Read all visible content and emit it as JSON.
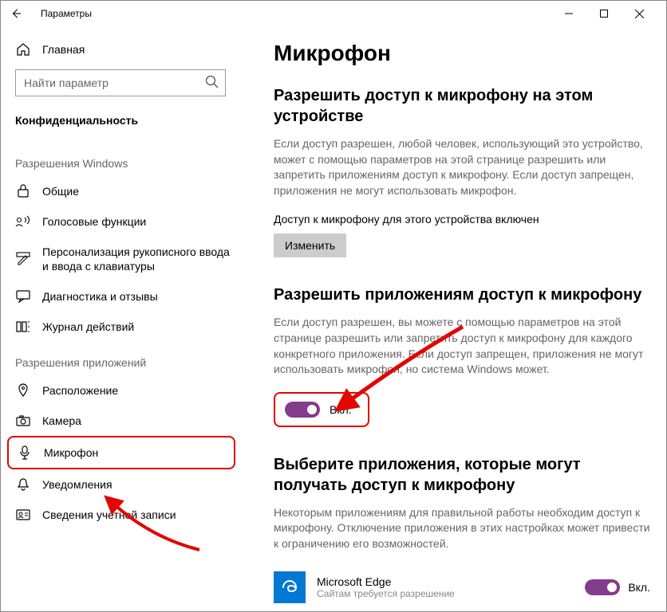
{
  "window": {
    "title": "Параметры"
  },
  "sidebar": {
    "home": "Главная",
    "search_placeholder": "Найти параметр",
    "category": "Конфиденциальность",
    "section_windows": "Разрешения Windows",
    "items_windows": [
      "Общие",
      "Голосовые функции",
      "Персонализация рукописного ввода и ввода с клавиатуры",
      "Диагностика и отзывы",
      "Журнал действий"
    ],
    "section_apps": "Разрешения приложений",
    "items_apps": [
      "Расположение",
      "Камера",
      "Микрофон",
      "Уведомления",
      "Сведения учетной записи"
    ]
  },
  "main": {
    "h1": "Микрофон",
    "sec1_title": "Разрешить доступ к микрофону на этом устройстве",
    "sec1_desc": "Если доступ разрешен, любой человек, использующий это устройство, может с помощью параметров на этой странице разрешить или запретить приложениям доступ к микрофону. Если доступ запрещен, приложения не могут использовать микрофон.",
    "sec1_status": "Доступ к микрофону для этого устройства включен",
    "change_btn": "Изменить",
    "sec2_title": "Разрешить приложениям доступ к микрофону",
    "sec2_desc": "Если доступ разрешен, вы можете с помощью параметров на этой странице разрешить или запретить доступ к микрофону для каждого конкретного приложения. Если доступ запрещен, приложения не могут использовать микрофон, но система Windows может.",
    "toggle_on": "Вкл.",
    "sec3_title": "Выберите приложения, которые могут получать доступ к микрофону",
    "sec3_desc": "Некоторым приложениям для правильной работы необходим доступ к микрофону. Отключение приложения в этих настройках может привести к ограничению его возможностей.",
    "app1_name": "Microsoft Edge",
    "app1_sub": "Сайтам требуется разрешение"
  }
}
